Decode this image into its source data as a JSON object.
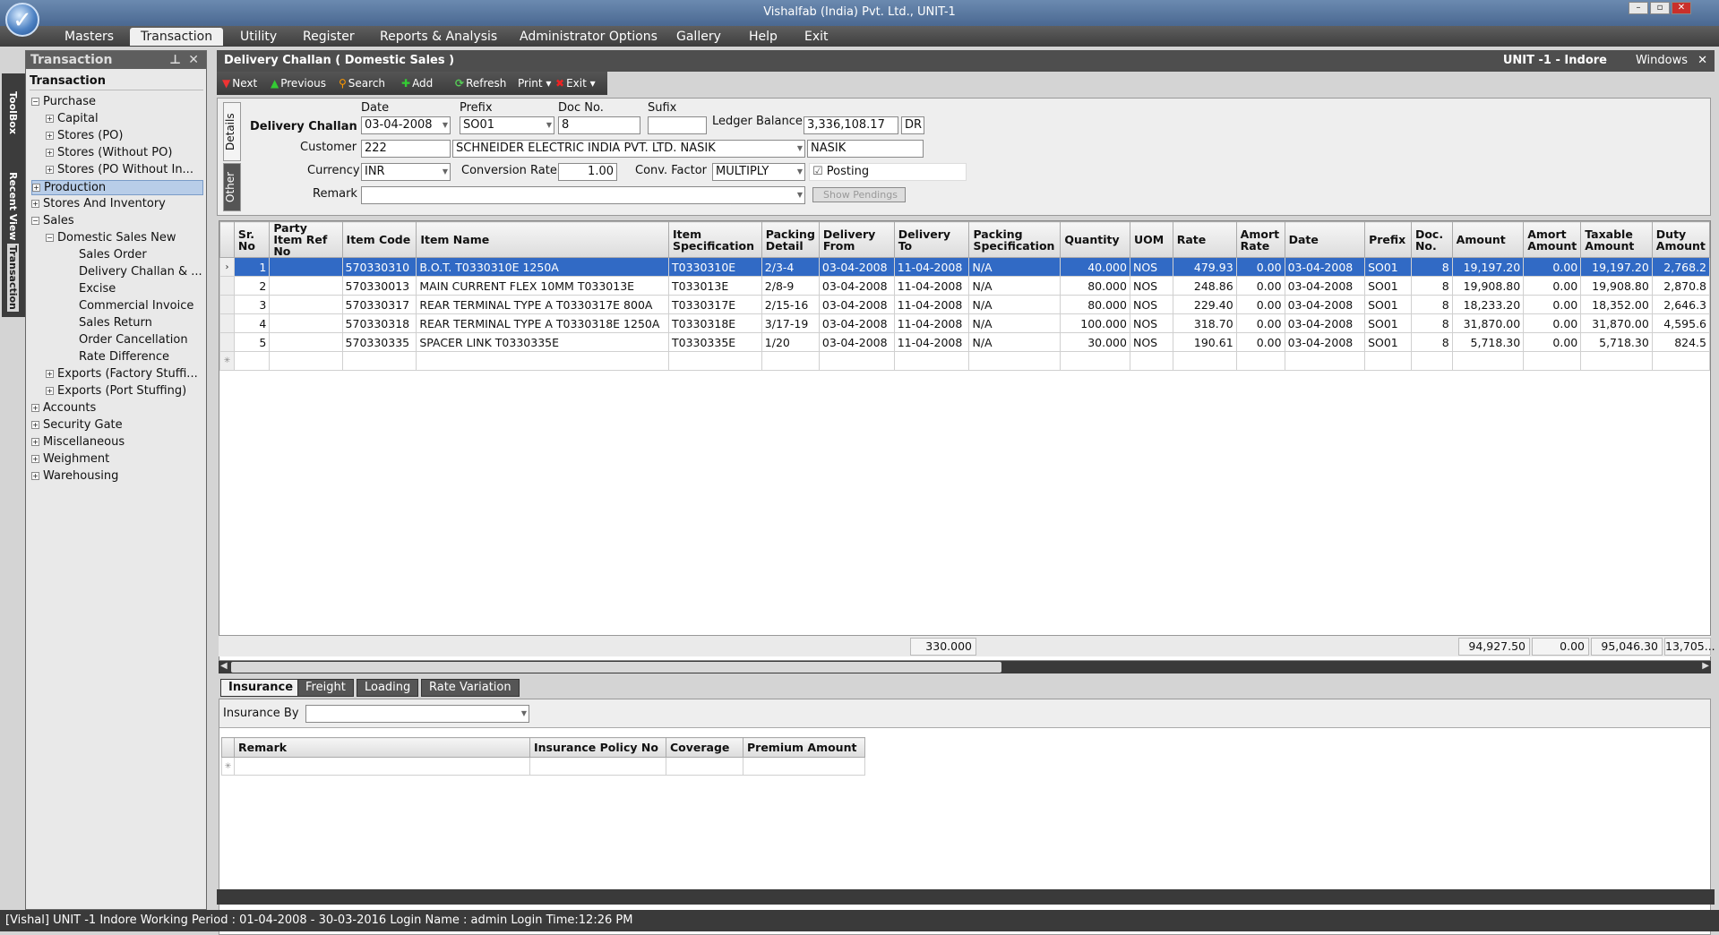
{
  "window": {
    "title": "Vishalfab (India) Pvt. Ltd., UNIT-1"
  },
  "menu": [
    "Masters",
    "Transaction",
    "Utility",
    "Register",
    "Reports & Analysis",
    "Administrator Options",
    "Gallery",
    "Help",
    "Exit"
  ],
  "left_strip": {
    "toolbox": "ToolBox",
    "recent": "Recent View",
    "transaction": "Transaction"
  },
  "nav": {
    "header": "Transaction",
    "subheader": "Transaction",
    "items": [
      "Purchase",
      "Capital",
      "Stores (PO)",
      "Stores (Without PO)",
      "Stores (PO Without In...",
      "Production",
      "Stores And Inventory",
      "Sales",
      "Domestic Sales New",
      "Sales Order",
      "Delivery Challan & ...",
      "Excise",
      "Commercial Invoice",
      "Sales Return",
      "Order Cancellation",
      "Rate Difference",
      "Exports (Factory Stuffi...",
      "Exports (Port Stuffing)",
      "Accounts",
      "Security Gate",
      "Miscellaneous",
      "Weighment",
      "Warehousing"
    ]
  },
  "form": {
    "title": "Delivery Challan ( Domestic Sales )",
    "unit": "UNIT -1 - Indore",
    "windows": "Windows",
    "close": "✕"
  },
  "toolbar": {
    "next": "Next",
    "previous": "Previous",
    "search": "Search",
    "add": "Add",
    "refresh": "Refresh",
    "print": "Print",
    "exit": "Exit"
  },
  "details": {
    "tab_details": "Details",
    "tab_other": "Other",
    "section_label": "Delivery Challan",
    "date_label": "Date",
    "date": "03-04-2008",
    "prefix_label": "Prefix",
    "prefix": "SO01",
    "docno_label": "Doc No.",
    "docno": "8",
    "sufix_label": "Sufix",
    "sufix": "",
    "ledger_label": "Ledger Balance",
    "ledger": "3,336,108.17",
    "ledger_type": "DR",
    "customer_label": "Customer",
    "customer_code": "222",
    "customer_name": "SCHNEIDER ELECTRIC INDIA PVT. LTD. NASIK",
    "customer_city": "NASIK",
    "currency_label": "Currency",
    "currency": "INR",
    "convrate_label": "Conversion Rate",
    "convrate": "1.00",
    "convfactor_label": "Conv. Factor",
    "convfactor": "MULTIPLY",
    "posting_label": "Posting",
    "remark_label": "Remark",
    "remark": "",
    "show_pendings": "Show Pendings"
  },
  "grid": {
    "columns": [
      "Sr. No",
      "Party Item Ref No",
      "Item Code",
      "Item Name",
      "Item Specification",
      "Packing Detail",
      "Delivery From",
      "Delivery To",
      "Packing Specification",
      "Quantity",
      "UOM",
      "Rate",
      "Amort Rate",
      "Date",
      "Prefix",
      "Doc. No.",
      "Amount",
      "Amort Amount",
      "Taxable Amount",
      "Duty Amount"
    ],
    "rows": [
      [
        "1",
        "",
        "570330310",
        "B.O.T. T0330310E 1250A",
        "T0330310E",
        "2/3-4",
        "03-04-2008",
        "11-04-2008",
        "N/A",
        "40.000",
        "NOS",
        "479.93",
        "0.00",
        "03-04-2008",
        "SO01",
        "8",
        "19,197.20",
        "0.00",
        "19,197.20",
        "2,768.2"
      ],
      [
        "2",
        "",
        "570330013",
        "MAIN CURRENT FLEX 10MM T033013E",
        "T033013E",
        "2/8-9",
        "03-04-2008",
        "11-04-2008",
        "N/A",
        "80.000",
        "NOS",
        "248.86",
        "0.00",
        "03-04-2008",
        "SO01",
        "8",
        "19,908.80",
        "0.00",
        "19,908.80",
        "2,870.8"
      ],
      [
        "3",
        "",
        "570330317",
        "REAR TERMINAL TYPE A T0330317E 800A",
        "T0330317E",
        "2/15-16",
        "03-04-2008",
        "11-04-2008",
        "N/A",
        "80.000",
        "NOS",
        "229.40",
        "0.00",
        "03-04-2008",
        "SO01",
        "8",
        "18,233.20",
        "0.00",
        "18,352.00",
        "2,646.3"
      ],
      [
        "4",
        "",
        "570330318",
        "REAR TERMINAL TYPE A T0330318E 1250A",
        "T0330318E",
        "3/17-19",
        "03-04-2008",
        "11-04-2008",
        "N/A",
        "100.000",
        "NOS",
        "318.70",
        "0.00",
        "03-04-2008",
        "SO01",
        "8",
        "31,870.00",
        "0.00",
        "31,870.00",
        "4,595.6"
      ],
      [
        "5",
        "",
        "570330335",
        "SPACER LINK T0330335E",
        "T0330335E",
        "1/20",
        "03-04-2008",
        "11-04-2008",
        "N/A",
        "30.000",
        "NOS",
        "190.61",
        "0.00",
        "03-04-2008",
        "SO01",
        "8",
        "5,718.30",
        "0.00",
        "5,718.30",
        "824.5"
      ]
    ],
    "totals": {
      "quantity": "330.000",
      "amount": "94,927.50",
      "amort": "0.00",
      "taxable": "95,046.30",
      "duty": "13,705..."
    }
  },
  "bottom": {
    "tabs": [
      "Insurance",
      "Freight",
      "Loading",
      "Rate Variation"
    ],
    "insurance_by_label": "Insurance By",
    "insurance_by": "",
    "columns": [
      "Remark",
      "Insurance Policy No",
      "Coverage",
      "Premium Amount"
    ]
  },
  "status": {
    "text": "[Vishal]  UNIT -1  Indore  Working Period : 01-04-2008 - 30-03-2016  Login Name : admin  Login Time:12:26 PM"
  }
}
